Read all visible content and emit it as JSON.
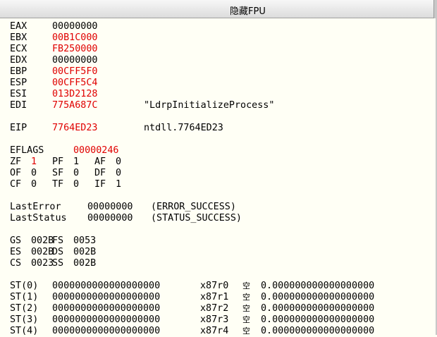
{
  "header": {
    "title": "隐藏FPU"
  },
  "registers": [
    {
      "name": "EAX",
      "value": "00000000",
      "changed": false,
      "comment": ""
    },
    {
      "name": "EBX",
      "value": "00B1C000",
      "changed": true,
      "comment": ""
    },
    {
      "name": "ECX",
      "value": "FB250000",
      "changed": true,
      "comment": ""
    },
    {
      "name": "EDX",
      "value": "00000000",
      "changed": false,
      "comment": ""
    },
    {
      "name": "EBP",
      "value": "00CFF5F0",
      "changed": true,
      "comment": ""
    },
    {
      "name": "ESP",
      "value": "00CFF5C4",
      "changed": true,
      "comment": ""
    },
    {
      "name": "ESI",
      "value": "013D2128",
      "changed": true,
      "comment": ""
    },
    {
      "name": "EDI",
      "value": "775A687C",
      "changed": true,
      "comment": "\"LdrpInitializeProcess\""
    }
  ],
  "eip": {
    "name": "EIP",
    "value": "7764ED23",
    "comment": "ntdll.7764ED23"
  },
  "eflags": {
    "name": "EFLAGS",
    "value": "00000246"
  },
  "flags": [
    [
      {
        "n": "ZF",
        "v": "1",
        "red": true
      },
      {
        "n": "PF",
        "v": "1",
        "red": false
      },
      {
        "n": "AF",
        "v": "0",
        "red": false
      }
    ],
    [
      {
        "n": "OF",
        "v": "0",
        "red": false
      },
      {
        "n": "SF",
        "v": "0",
        "red": false
      },
      {
        "n": "DF",
        "v": "0",
        "red": false
      }
    ],
    [
      {
        "n": "CF",
        "v": "0",
        "red": false
      },
      {
        "n": "TF",
        "v": "0",
        "red": false
      },
      {
        "n": "IF",
        "v": "1",
        "red": false
      }
    ]
  ],
  "last_error": {
    "label": "LastError",
    "value": "00000000",
    "text": "(ERROR_SUCCESS)"
  },
  "last_status": {
    "label": "LastStatus",
    "value": "00000000",
    "text": "(STATUS_SUCCESS)"
  },
  "segments": [
    [
      {
        "n": "GS",
        "v": "002B"
      },
      {
        "n": "FS",
        "v": "0053"
      }
    ],
    [
      {
        "n": "ES",
        "v": "002B"
      },
      {
        "n": "DS",
        "v": "002B"
      }
    ],
    [
      {
        "n": "CS",
        "v": "0023"
      },
      {
        "n": "SS",
        "v": "002B"
      }
    ]
  ],
  "fpu": [
    {
      "st": "ST(0)",
      "raw": "0000000000000000000",
      "reg": "x87r0",
      "tag": "空",
      "val": "0.000000000000000000"
    },
    {
      "st": "ST(1)",
      "raw": "0000000000000000000",
      "reg": "x87r1",
      "tag": "空",
      "val": "0.000000000000000000"
    },
    {
      "st": "ST(2)",
      "raw": "0000000000000000000",
      "reg": "x87r2",
      "tag": "空",
      "val": "0.000000000000000000"
    },
    {
      "st": "ST(3)",
      "raw": "0000000000000000000",
      "reg": "x87r3",
      "tag": "空",
      "val": "0.000000000000000000"
    },
    {
      "st": "ST(4)",
      "raw": "0000000000000000000",
      "reg": "x87r4",
      "tag": "空",
      "val": "0.000000000000000000"
    }
  ],
  "colors": {
    "changed": "#E00000",
    "background": "#FFFFF5"
  }
}
